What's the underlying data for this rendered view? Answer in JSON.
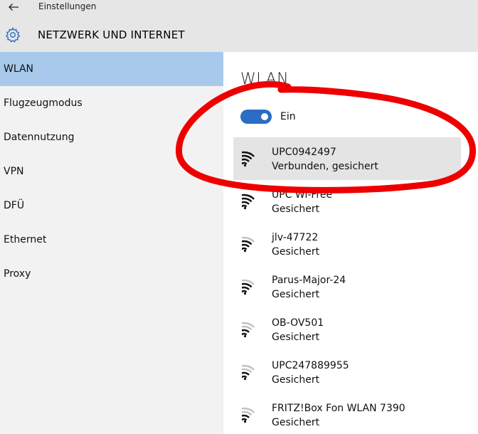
{
  "window": {
    "app_title": "Einstellungen",
    "page_title": "NETZWERK UND INTERNET"
  },
  "sidebar": {
    "items": [
      {
        "label": "WLAN",
        "selected": true
      },
      {
        "label": "Flugzeugmodus",
        "selected": false
      },
      {
        "label": "Datennutzung",
        "selected": false
      },
      {
        "label": "VPN",
        "selected": false
      },
      {
        "label": "DFÜ",
        "selected": false
      },
      {
        "label": "Ethernet",
        "selected": false
      },
      {
        "label": "Proxy",
        "selected": false
      }
    ]
  },
  "main": {
    "title": "WLAN",
    "toggle": {
      "label": "Ein",
      "on": true
    },
    "networks": [
      {
        "name": "UPC0942497",
        "status": "Verbunden, gesichert",
        "signal": 4,
        "connected": true
      },
      {
        "name": "UPC Wi-Free",
        "status": "Gesichert",
        "signal": 4,
        "connected": false
      },
      {
        "name": "jlv-47722",
        "status": "Gesichert",
        "signal": 3,
        "connected": false
      },
      {
        "name": "Parus-Major-24",
        "status": "Gesichert",
        "signal": 3,
        "connected": false
      },
      {
        "name": "OB-OV501",
        "status": "Gesichert",
        "signal": 2,
        "connected": false
      },
      {
        "name": "UPC247889955",
        "status": "Gesichert",
        "signal": 2,
        "connected": false
      },
      {
        "name": "FRITZ!Box Fon WLAN 7390",
        "status": "Gesichert",
        "signal": 2,
        "connected": false
      }
    ]
  },
  "colors": {
    "accent": "#2b6cc4",
    "selection": "#a8c9ec",
    "annotation_red": "#ee0000"
  }
}
